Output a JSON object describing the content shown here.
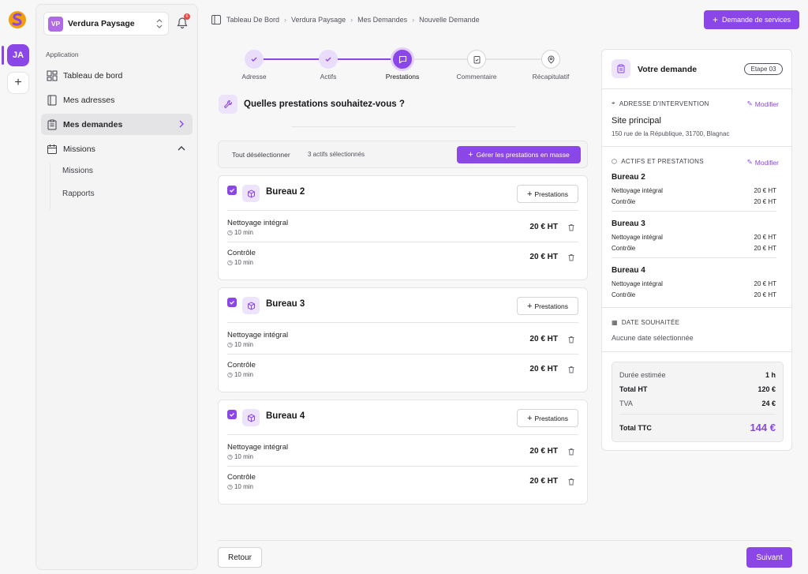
{
  "rail": {
    "avatar": "JA"
  },
  "sidebar": {
    "workspace": {
      "avatar": "VP",
      "name": "Verdura Paysage"
    },
    "notifications": {
      "count": "6"
    },
    "group_label": "Application",
    "items": [
      {
        "label": "Tableau de bord"
      },
      {
        "label": "Mes adresses"
      },
      {
        "label": "Mes demandes"
      },
      {
        "label": "Missions"
      }
    ],
    "subitems": [
      {
        "label": "Missions"
      },
      {
        "label": "Rapports"
      }
    ]
  },
  "breadcrumb": [
    "Tableau De Bord",
    "Verdura Paysage",
    "Mes Demandes",
    "Nouvelle Demande"
  ],
  "header": {
    "action_label": "Demande de services"
  },
  "stepper": {
    "steps": [
      {
        "label": "Adresse",
        "status": "done"
      },
      {
        "label": "Actifs",
        "status": "done"
      },
      {
        "label": "Prestations",
        "status": "current"
      },
      {
        "label": "Commentaire",
        "status": "todo"
      },
      {
        "label": "Récapitulatif",
        "status": "todo"
      }
    ]
  },
  "question": {
    "title": "Quelles prestations souhaitez-vous ?"
  },
  "toolbar": {
    "deselect_label": "Tout désélectionner",
    "count_label": "3 actifs sélectionnés",
    "bulk_label": "Gérer les prestations en masse"
  },
  "cards": [
    {
      "title": "Bureau 2",
      "button": "Prestations",
      "services": [
        {
          "name": "Nettoyage intégral",
          "duration": "10 min",
          "price": "20 € HT"
        },
        {
          "name": "Contrôle",
          "duration": "10 min",
          "price": "20 € HT"
        }
      ]
    },
    {
      "title": "Bureau 3",
      "button": "Prestations",
      "services": [
        {
          "name": "Nettoyage intégral",
          "duration": "10 min",
          "price": "20 € HT"
        },
        {
          "name": "Contrôle",
          "duration": "10 min",
          "price": "20 € HT"
        }
      ]
    },
    {
      "title": "Bureau 4",
      "button": "Prestations",
      "services": [
        {
          "name": "Nettoyage intégral",
          "duration": "10 min",
          "price": "20 € HT"
        },
        {
          "name": "Contrôle",
          "duration": "10 min",
          "price": "20 € HT"
        }
      ]
    }
  ],
  "footer": {
    "back_label": "Retour",
    "next_label": "Suivant"
  },
  "summary": {
    "title": "Votre demande",
    "badge": "Etape 03",
    "address": {
      "heading": "ADRESSE D'INTERVENTION",
      "edit": "Modifier",
      "name": "Site principal",
      "line": "150 rue de la République, 31700, Blagnac"
    },
    "assets": {
      "heading": "ACTIFS ET PRESTATIONS",
      "edit": "Modifier",
      "groups": [
        {
          "title": "Bureau 2",
          "rows": [
            {
              "name": "Nettoyage intégral",
              "price": "20 € HT"
            },
            {
              "name": "Contrôle",
              "price": "20 € HT"
            }
          ]
        },
        {
          "title": "Bureau 3",
          "rows": [
            {
              "name": "Nettoyage intégral",
              "price": "20 € HT"
            },
            {
              "name": "Contrôle",
              "price": "20 € HT"
            }
          ]
        },
        {
          "title": "Bureau 4",
          "rows": [
            {
              "name": "Nettoyage intégral",
              "price": "20 € HT"
            },
            {
              "name": "Contrôle",
              "price": "20 € HT"
            }
          ]
        }
      ]
    },
    "date": {
      "heading": "DATE SOUHAITÉE",
      "value": "Aucune date sélectionnée"
    },
    "totals": {
      "duration_label": "Durée estimée",
      "duration_value": "1 h",
      "ht_label": "Total HT",
      "ht_value": "120 €",
      "tva_label": "TVA",
      "tva_value": "24 €",
      "ttc_label": "Total TTC",
      "ttc_value": "144 €"
    }
  },
  "colors": {
    "accent": "#8b46e8",
    "accent_soft": "#ede4fb"
  }
}
